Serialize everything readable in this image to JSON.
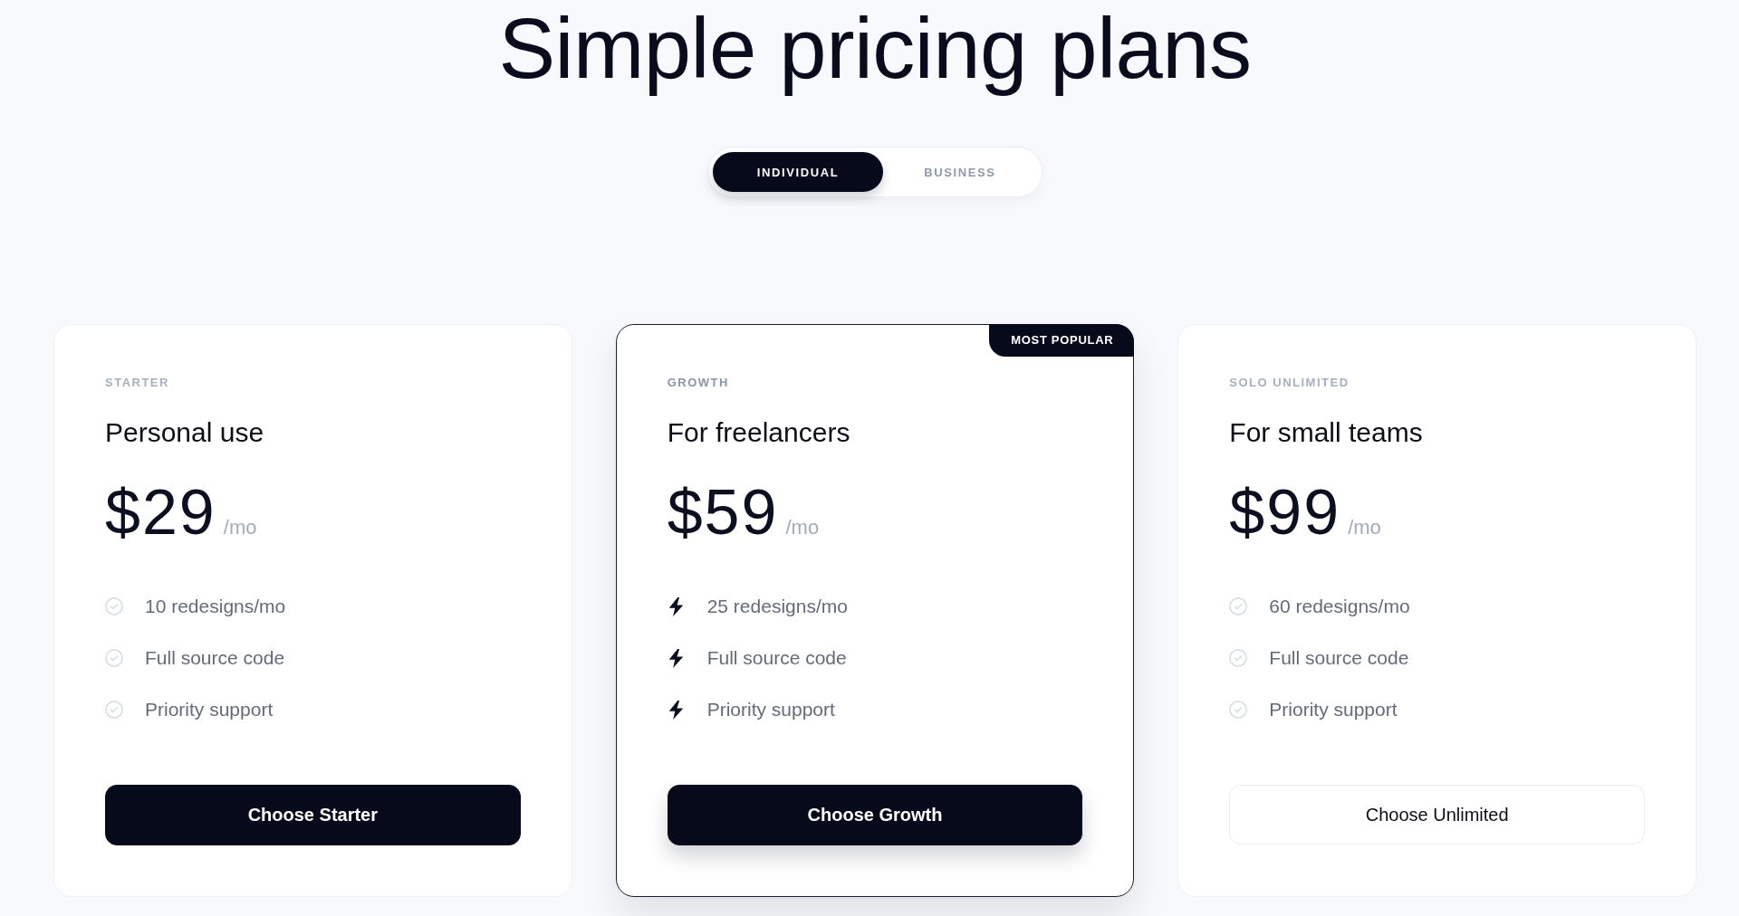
{
  "heading": "Simple pricing plans",
  "plan_toggle": [
    {
      "label": "INDIVIDUAL",
      "selected": true
    },
    {
      "label": "BUSINESS",
      "selected": false
    }
  ],
  "plans": [
    {
      "tier": "STARTER",
      "title": "Personal use",
      "price": "$29",
      "period": "/mo",
      "highlighted": false,
      "features": [
        {
          "kind": "check",
          "text": "10 redesigns/mo"
        },
        {
          "kind": "check",
          "text": "Full source code"
        },
        {
          "kind": "check",
          "text": "Priority support"
        }
      ],
      "button": {
        "label": "Choose Starter",
        "kind": "filled"
      }
    },
    {
      "tier": "GROWTH",
      "title": "For freelancers",
      "price": "$59",
      "period": "/mo",
      "highlighted": true,
      "badge": "MOST POPULAR",
      "features": [
        {
          "kind": "bolt",
          "text": "25 redesigns/mo"
        },
        {
          "kind": "bolt",
          "text": "Full source code"
        },
        {
          "kind": "bolt",
          "text": "Priority support"
        }
      ],
      "button": {
        "label": "Choose Growth",
        "kind": "filled"
      }
    },
    {
      "tier": "SOLO UNLIMITED",
      "title": "For small teams",
      "price": "$99",
      "period": "/mo",
      "highlighted": false,
      "features": [
        {
          "kind": "check",
          "text": "60 redesigns/mo"
        },
        {
          "kind": "check",
          "text": "Full source code"
        },
        {
          "kind": "check",
          "text": "Priority support"
        }
      ],
      "button": {
        "label": "Choose Unlimited",
        "kind": "outline"
      }
    }
  ]
}
